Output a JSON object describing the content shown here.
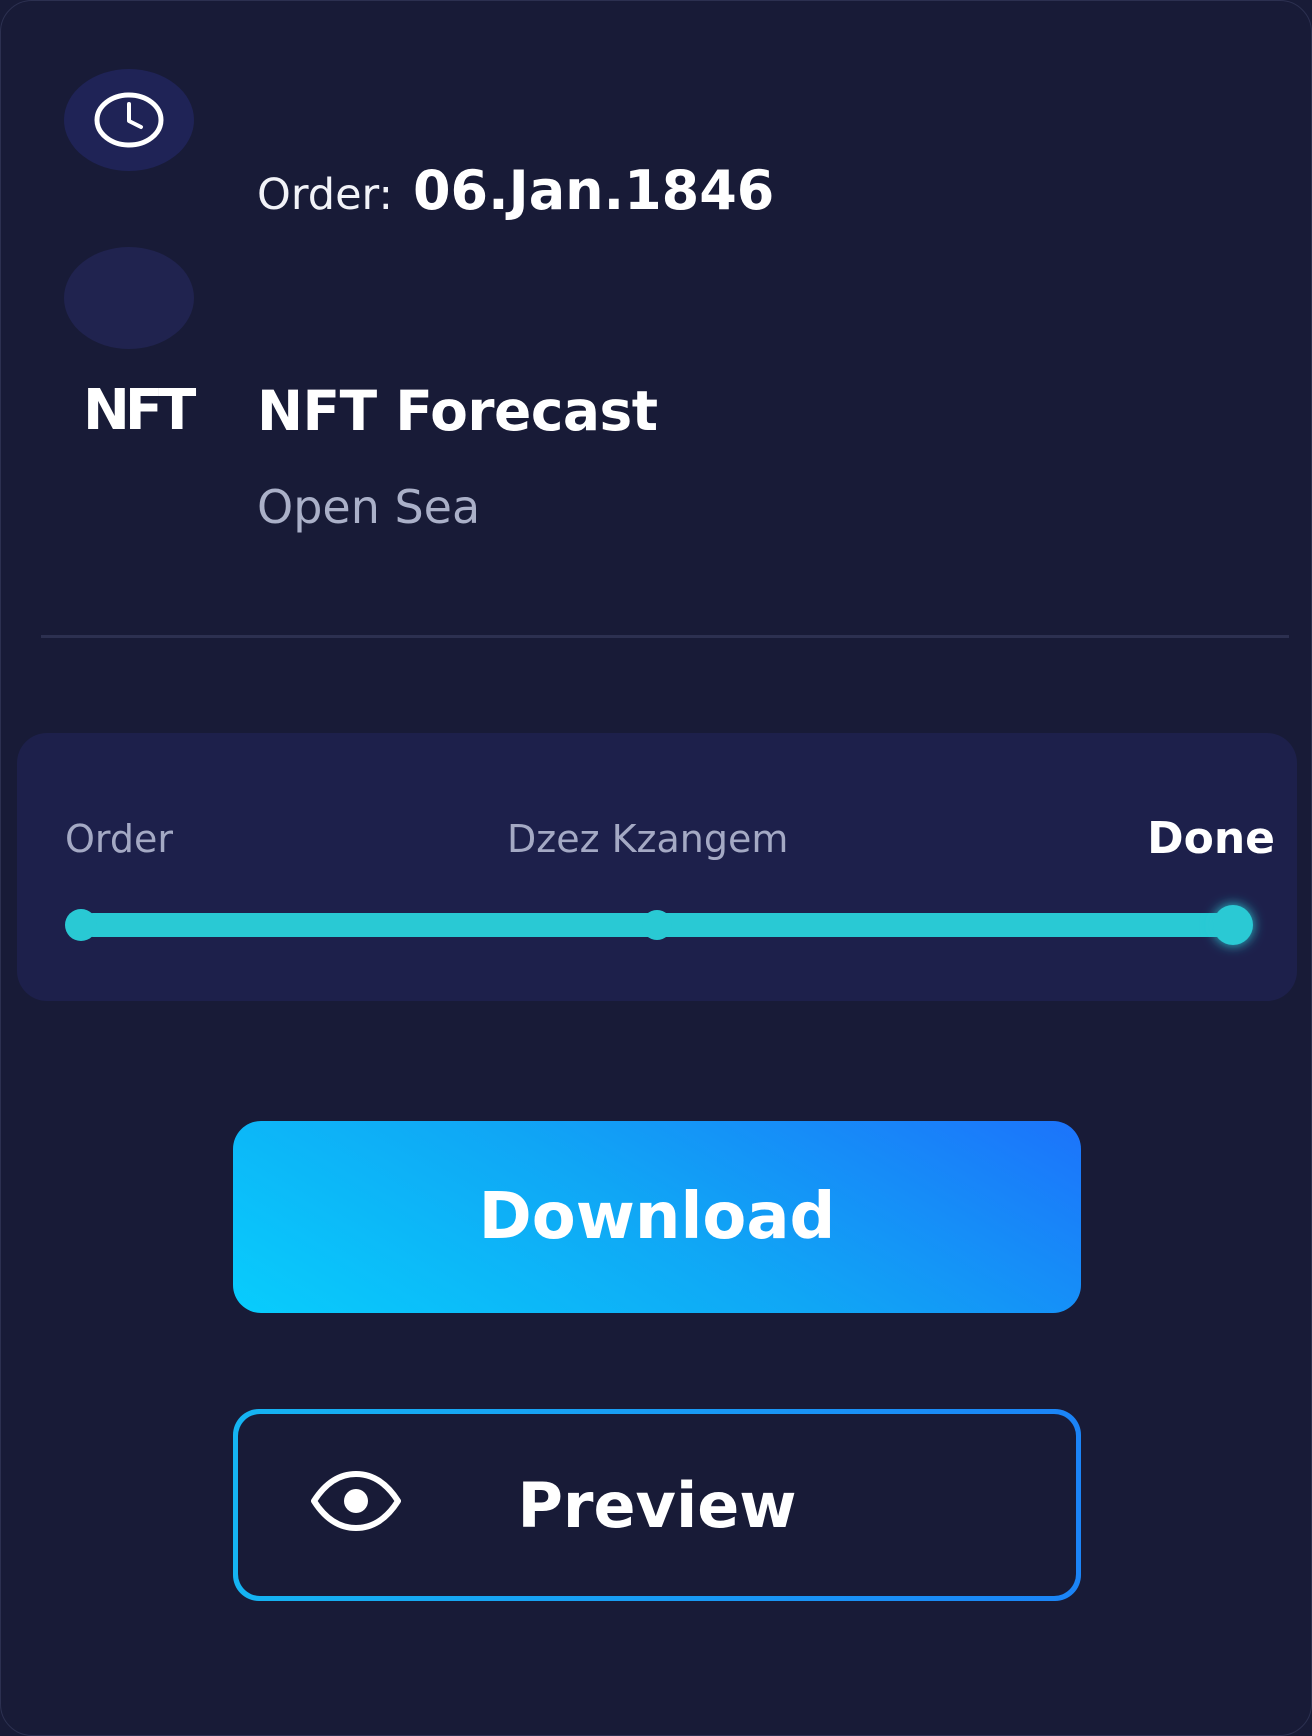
{
  "order": {
    "label": "Order:",
    "date": "06.Jan.1846"
  },
  "item": {
    "logo_text": "NFT",
    "name": "NFT Forecast",
    "marketplace": "Open Sea"
  },
  "progress": {
    "steps": [
      {
        "label": "Order"
      },
      {
        "label": "Dzez Kzangem"
      },
      {
        "label": "Done"
      }
    ],
    "current_step": "Done",
    "completed_fraction": 1.0,
    "accent_color": "#29c9d4"
  },
  "actions": {
    "download_label": "Download",
    "preview_label": "Preview"
  },
  "icons": {
    "order": "clock-icon",
    "preview": "eye-icon"
  }
}
